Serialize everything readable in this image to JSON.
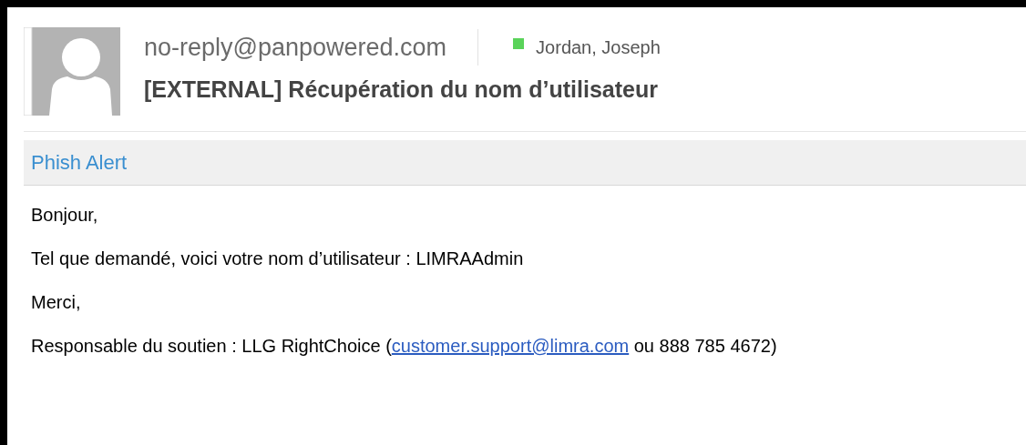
{
  "header": {
    "sender": "no-reply@panpowered.com",
    "recipient": {
      "name": "Jordan, Joseph",
      "online": true
    },
    "subject": "[EXTERNAL] Récupération du nom d’utilisateur"
  },
  "addin_bar": {
    "label": "Phish Alert"
  },
  "body": [
    {
      "text": "Bonjour,"
    },
    {
      "text": "Tel que demandé, voici votre nom d’utilisateur : LIMRAAdmin"
    },
    {
      "text": "Merci,"
    },
    {
      "text": "Responsable du soutien : LLG RightChoice (",
      "link": "customer.support@limra.com",
      "after": " ou 888 785 4672)"
    }
  ]
}
